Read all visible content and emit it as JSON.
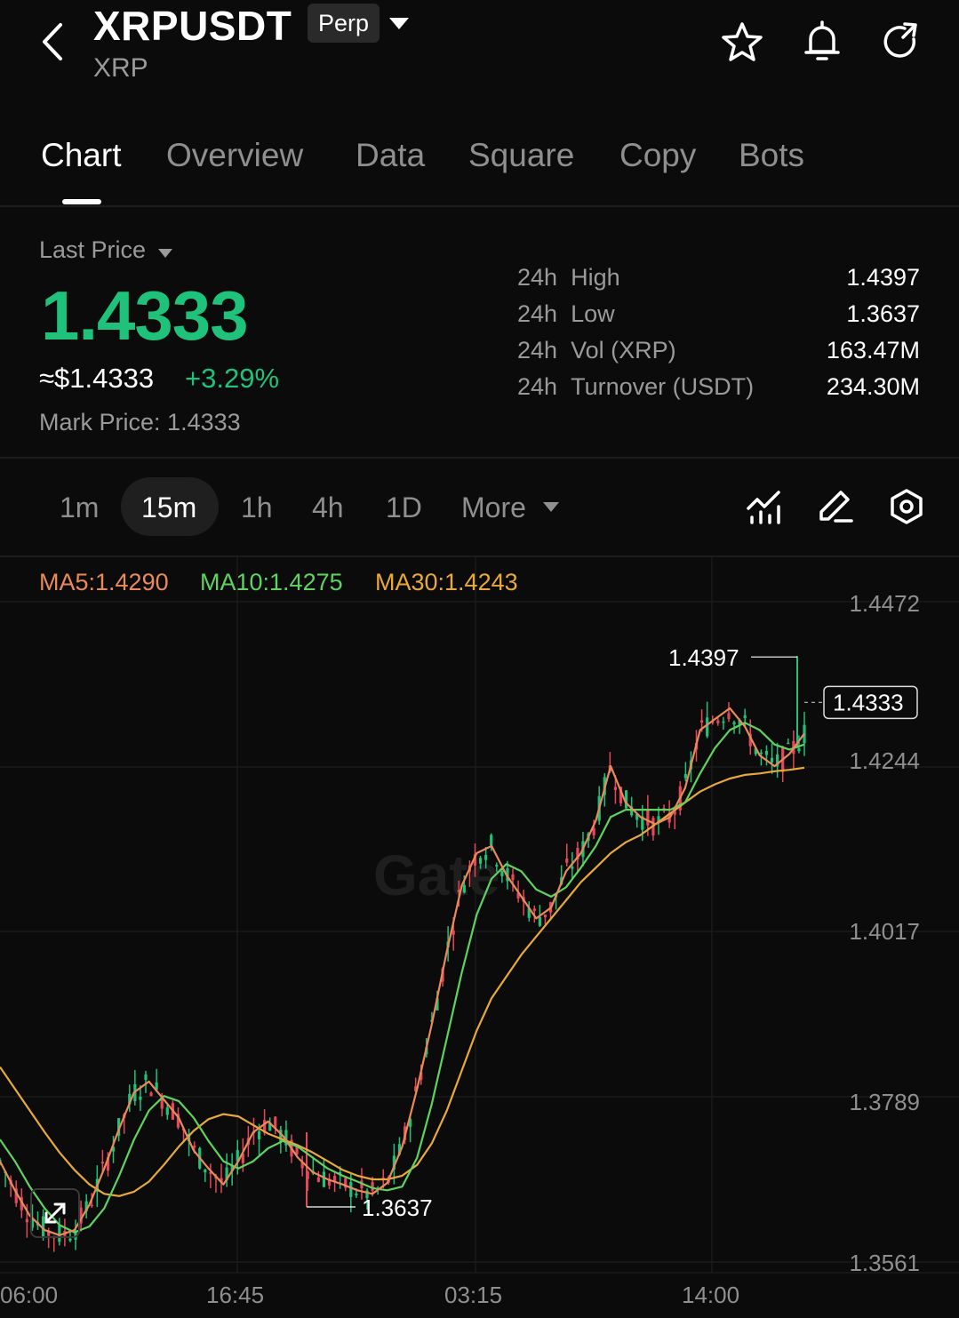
{
  "header": {
    "symbol": "XRPUSDT",
    "badge": "Perp",
    "base_asset": "XRP",
    "icons": [
      "back-arrow-icon",
      "star-icon",
      "bell-icon",
      "refresh-icon"
    ]
  },
  "tabs": [
    {
      "label": "Chart",
      "active": true
    },
    {
      "label": "Overview",
      "active": false
    },
    {
      "label": "Data",
      "active": false
    },
    {
      "label": "Square",
      "active": false
    },
    {
      "label": "Copy",
      "active": false
    },
    {
      "label": "Bots",
      "active": false
    }
  ],
  "price": {
    "last_price_label": "Last Price",
    "last_price": "1.4333",
    "usd_value": "≈$1.4333",
    "change": "+3.29%",
    "mark_label": "Mark Price:",
    "mark_value": "1.4333"
  },
  "stats": [
    {
      "period": "24h",
      "label": "High",
      "value": "1.4397"
    },
    {
      "period": "24h",
      "label": "Low",
      "value": "1.3637"
    },
    {
      "period": "24h",
      "label": "Vol (XRP)",
      "value": "163.47M"
    },
    {
      "period": "24h",
      "label": "Turnover (USDT)",
      "value": "234.30M"
    }
  ],
  "intervals": {
    "items": [
      "1m",
      "15m",
      "1h",
      "4h",
      "1D"
    ],
    "selected": "15m",
    "more_label": "More"
  },
  "tool_icons": [
    "indicator-icon",
    "draw-pen-icon",
    "settings-hexagon-icon"
  ],
  "chart": {
    "ma_labels": [
      {
        "text": "MA5:1.4290",
        "color": "#e88a5a"
      },
      {
        "text": "MA10:1.4275",
        "color": "#5fd35f"
      },
      {
        "text": "MA30:1.4243",
        "color": "#e8a93b"
      }
    ],
    "y_ticks": [
      "1.4472",
      "1.4244",
      "1.4017",
      "1.3789",
      "1.3561"
    ],
    "x_ticks": [
      "06:00",
      "16:45",
      "03:15",
      "14:00"
    ],
    "high_marker": "1.4397",
    "low_marker": "1.3637",
    "current_price_tag": "1.4333",
    "watermark": "Gate",
    "colors": {
      "up": "#1fc27b",
      "down": "#e5475b"
    }
  },
  "chart_data": {
    "type": "candlestick",
    "interval": "15m",
    "y_ticks": [
      1.4472,
      1.4244,
      1.4017,
      1.3789,
      1.3561
    ],
    "x_ticks": [
      "06:00",
      "16:45",
      "03:15",
      "14:00"
    ],
    "high": 1.4397,
    "low": 1.3637,
    "last": 1.4333,
    "ma5_path": [
      1.37,
      1.366,
      1.3625,
      1.3605,
      1.3598,
      1.3605,
      1.364,
      1.369,
      1.3745,
      1.3795,
      1.381,
      1.3785,
      1.376,
      1.3715,
      1.369,
      1.3668,
      1.37,
      1.374,
      1.3755,
      1.3735,
      1.3705,
      1.3685,
      1.3675,
      1.3668,
      1.366,
      1.3655,
      1.367,
      1.372,
      1.38,
      1.389,
      1.399,
      1.408,
      1.4125,
      1.4135,
      1.4095,
      1.4065,
      1.4035,
      1.405,
      1.41,
      1.4125,
      1.417,
      1.4245,
      1.4195,
      1.4175,
      1.4165,
      1.4175,
      1.4215,
      1.4295,
      1.431,
      1.4325,
      1.43,
      1.426,
      1.4245,
      1.4262,
      1.429
    ],
    "ma10_path": [
      1.373,
      1.37,
      1.3665,
      1.3635,
      1.3612,
      1.3602,
      1.361,
      1.3635,
      1.368,
      1.373,
      1.377,
      1.379,
      1.3783,
      1.376,
      1.3728,
      1.37,
      1.369,
      1.37,
      1.3718,
      1.3728,
      1.372,
      1.3705,
      1.369,
      1.368,
      1.3672,
      1.3663,
      1.366,
      1.3665,
      1.3705,
      1.378,
      1.387,
      1.396,
      1.404,
      1.409,
      1.411,
      1.41,
      1.4075,
      1.4065,
      1.4078,
      1.4105,
      1.4135,
      1.4175,
      1.4185,
      1.4185,
      1.4185,
      1.4185,
      1.4195,
      1.4235,
      1.427,
      1.4295,
      1.4305,
      1.4295,
      1.4275,
      1.4268,
      1.4275
    ],
    "ma30_path": [
      1.383,
      1.38,
      1.377,
      1.374,
      1.3712,
      1.3688,
      1.3668,
      1.3655,
      1.3652,
      1.3658,
      1.3672,
      1.3695,
      1.372,
      1.3742,
      1.3758,
      1.3765,
      1.3762,
      1.375,
      1.3738,
      1.373,
      1.3722,
      1.3712,
      1.37,
      1.3688,
      1.368,
      1.3675,
      1.3675,
      1.368,
      1.3695,
      1.3725,
      1.377,
      1.3825,
      1.388,
      1.3925,
      1.3955,
      1.3985,
      1.401,
      1.4035,
      1.406,
      1.4085,
      1.4105,
      1.4125,
      1.414,
      1.415,
      1.4165,
      1.418,
      1.4195,
      1.421,
      1.422,
      1.4228,
      1.4233,
      1.4235,
      1.4238,
      1.424,
      1.4243
    ]
  }
}
